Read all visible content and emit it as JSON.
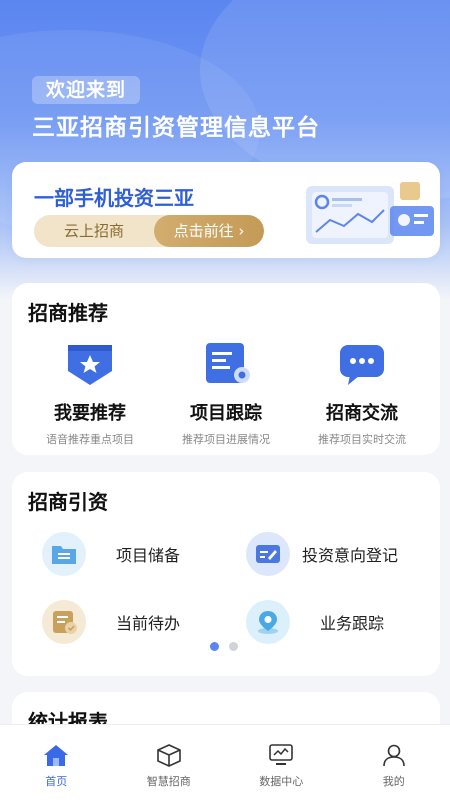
{
  "header": {
    "welcome": "欢迎来到",
    "title": "三亚招商引资管理信息平台"
  },
  "banner": {
    "title": "一部手机投资三亚",
    "tag": "云上招商",
    "action": "点击前往 ›"
  },
  "recommend": {
    "title": "招商推荐",
    "items": [
      {
        "label": "我要推荐",
        "desc": "语音推荐重点项目",
        "icon": "star-badge-icon"
      },
      {
        "label": "项目跟踪",
        "desc": "推荐项目进展情况",
        "icon": "document-track-icon"
      },
      {
        "label": "招商交流",
        "desc": "推荐项目实时交流",
        "icon": "chat-bubble-icon"
      }
    ]
  },
  "investment": {
    "title": "招商引资",
    "items": [
      {
        "label": "项目储备",
        "icon": "folder-icon",
        "color": "#5aa7e8"
      },
      {
        "label": "投资意向登记",
        "icon": "form-edit-icon",
        "color": "#4b78e0"
      },
      {
        "label": "当前待办",
        "icon": "todo-icon",
        "color": "#c9a05c"
      },
      {
        "label": "业务跟踪",
        "icon": "location-icon",
        "color": "#49a9e6"
      }
    ],
    "page_count": 2,
    "active_page": 1
  },
  "stats": {
    "title": "统计报表"
  },
  "tabbar": {
    "items": [
      {
        "label": "首页",
        "icon": "home-icon",
        "active": true
      },
      {
        "label": "智慧招商",
        "icon": "box-icon",
        "active": false
      },
      {
        "label": "数据中心",
        "icon": "monitor-icon",
        "active": false
      },
      {
        "label": "我的",
        "icon": "user-icon",
        "active": false
      }
    ]
  },
  "colors": {
    "primary": "#3a6ae6",
    "gold": "#c49a56"
  }
}
